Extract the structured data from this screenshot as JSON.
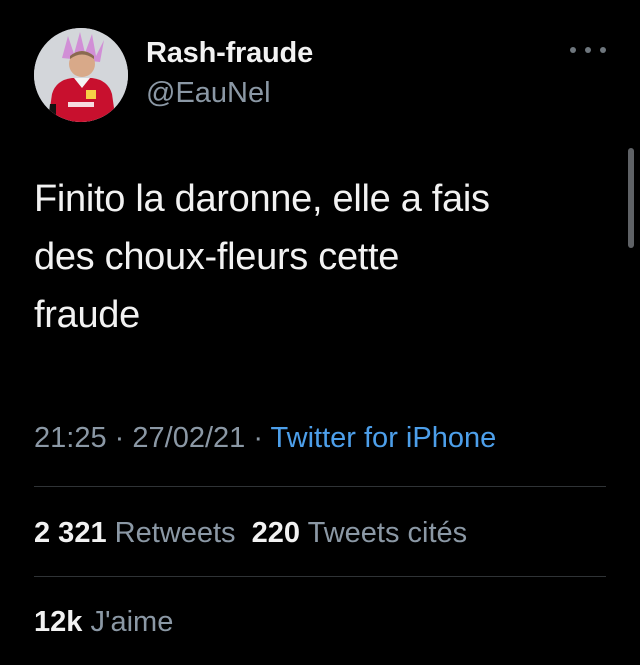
{
  "user": {
    "display_name": "Rash-fraude",
    "handle": "@EauNel",
    "avatar_icon": "profile-avatar-football-player"
  },
  "more_icon": "more-options-icon",
  "tweet": {
    "lines": [
      "Finito la daronne, elle a fais",
      "des choux-fleurs cette",
      "fraude"
    ],
    "time": "21:25",
    "date": "27/02/21",
    "separator": "·",
    "source": "Twitter for iPhone"
  },
  "stats": {
    "retweets_count": "2 321",
    "retweets_label": "Retweets",
    "quotes_count": "220",
    "quotes_label": "Tweets cités",
    "likes_count": "12k",
    "likes_label": "J'aime"
  },
  "colors": {
    "background": "#000000",
    "text": "#f2f2f2",
    "muted": "#8b98a5",
    "link": "#4d9fea",
    "divider": "#2f3336"
  }
}
